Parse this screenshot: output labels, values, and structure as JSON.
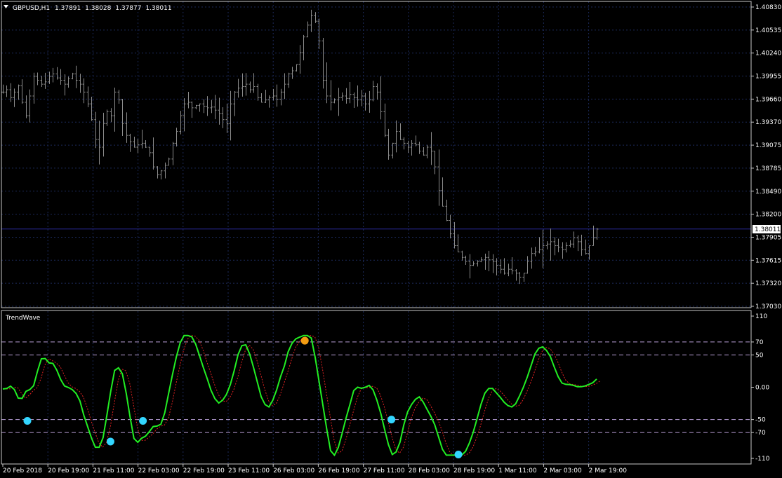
{
  "header": {
    "symbol": "GBPUSD,H1",
    "open": "1.37891",
    "high": "1.38028",
    "low": "1.37877",
    "close": "1.38011"
  },
  "colors": {
    "background": "#000000",
    "grid": "#1c2a5a",
    "frame": "#c8c8c8",
    "text": "#ffffff",
    "bars": "#8c8c8c",
    "price_line": "#2a2aa0",
    "indicator_main": "#22ee22",
    "indicator_signal": "#dd2222",
    "levels": "#b9a0d8",
    "signal_up": "#33d6ff",
    "signal_down": "#f39c12"
  },
  "price_axis": {
    "labels": [
      "1.40830",
      "1.40535",
      "1.40240",
      "1.39955",
      "1.39660",
      "1.39370",
      "1.39075",
      "1.38785",
      "1.38490",
      "1.38200",
      "1.37905",
      "1.37615",
      "1.37320",
      "1.37030"
    ],
    "current_price": "1.38011"
  },
  "indicator": {
    "name": "TrendWave",
    "axis_labels": [
      "110",
      "70",
      "50",
      "0.00",
      "-50",
      "-70",
      "-110"
    ],
    "levels": [
      70,
      50,
      -50,
      -70
    ]
  },
  "time_axis": {
    "labels": [
      "20 Feb 2018",
      "20 Feb 19:00",
      "21 Feb 11:00",
      "22 Feb 03:00",
      "22 Feb 19:00",
      "23 Feb 11:00",
      "26 Feb 03:00",
      "26 Feb 19:00",
      "27 Feb 11:00",
      "28 Feb 03:00",
      "28 Feb 19:00",
      "1 Mar 11:00",
      "2 Mar 03:00",
      "2 Mar 19:00"
    ]
  },
  "chart_data": {
    "type": "line",
    "title": "GBPUSD,H1",
    "price_ylim": [
      1.3703,
      1.4083
    ],
    "indicator_ylim": [
      -110,
      110
    ],
    "price_close_path": [
      1.3975,
      1.3978,
      1.3968,
      1.3975,
      1.3983,
      1.3962,
      1.3945,
      1.397,
      1.3995,
      1.399,
      1.3985,
      1.3988,
      1.3995,
      1.3998,
      1.3993,
      1.399,
      1.3985,
      1.3992,
      1.3998,
      1.399,
      1.3985,
      1.3975,
      1.396,
      1.394,
      1.3915,
      1.3905,
      1.3935,
      1.395,
      1.3945,
      1.3975,
      1.3965,
      1.3935,
      1.392,
      1.3912,
      1.3905,
      1.3908,
      1.391,
      1.3905,
      1.3898,
      1.388,
      1.387,
      1.3875,
      1.3882,
      1.389,
      1.391,
      1.3925,
      1.3945,
      1.396,
      1.3962,
      1.3955,
      1.3958,
      1.396,
      1.3957,
      1.3955,
      1.3956,
      1.3952,
      1.3948,
      1.394,
      1.3935,
      1.396,
      1.3975,
      1.398,
      1.3982,
      1.3985,
      1.3978,
      1.3982,
      1.3968,
      1.3962,
      1.3965,
      1.3968,
      1.397,
      1.3966,
      1.3975,
      1.3985,
      1.3998,
      1.4002,
      1.401,
      1.4025,
      1.4045,
      1.406,
      1.4072,
      1.4065,
      1.404,
      1.399,
      1.397,
      1.3962,
      1.3965,
      1.3968,
      1.397,
      1.3967,
      1.3972,
      1.3968,
      1.3965,
      1.397,
      1.396,
      1.3965,
      1.3982,
      1.3975,
      1.395,
      1.392,
      1.3895,
      1.391,
      1.3925,
      1.3915,
      1.391,
      1.3905,
      1.391,
      1.3908,
      1.39,
      1.3895,
      1.3905,
      1.39,
      1.388,
      1.385,
      1.383,
      1.3812,
      1.3795,
      1.378,
      1.3772,
      1.3765,
      1.376,
      1.3755,
      1.3757,
      1.376,
      1.3762,
      1.3765,
      1.3762,
      1.376,
      1.3755,
      1.375,
      1.3745,
      1.375,
      1.3748,
      1.3745,
      1.374,
      1.3745,
      1.376,
      1.377,
      1.3772,
      1.3775,
      1.378,
      1.3782,
      1.3785,
      1.378,
      1.3778,
      1.3775,
      1.378,
      1.3782,
      1.379,
      1.3785,
      1.3775,
      1.377,
      1.378,
      1.379,
      1.3801
    ],
    "signal_points": [
      {
        "time": "20 Feb 2018",
        "value": -52,
        "kind": "up"
      },
      {
        "time": "21 Feb 11:00",
        "value": -84,
        "kind": "up"
      },
      {
        "time": "22 Feb 03:00",
        "value": -52,
        "kind": "up"
      },
      {
        "time": "26 Feb 03:00",
        "value": 72,
        "kind": "down"
      },
      {
        "time": "27 Feb 11:00",
        "value": -50,
        "kind": "up"
      },
      {
        "time": "28 Feb 19:00",
        "value": -104,
        "kind": "up"
      }
    ]
  }
}
